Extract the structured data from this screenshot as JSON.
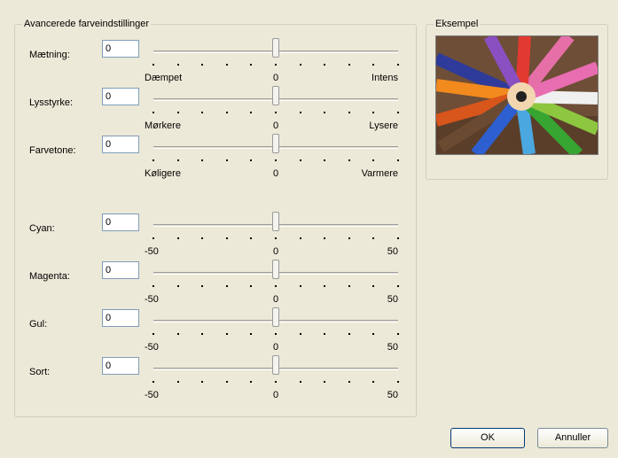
{
  "advanced_group": {
    "title": "Avancerede farveindstillinger"
  },
  "sliders": [
    {
      "id": "saturation",
      "label": "Mætning:",
      "value": "0",
      "min_label": "Dæmpet",
      "mid_label": "0",
      "max_label": "Intens",
      "level": 0.5
    },
    {
      "id": "brightness",
      "label": "Lysstyrke:",
      "value": "0",
      "min_label": "Mørkere",
      "mid_label": "0",
      "max_label": "Lysere",
      "level": 0.5
    },
    {
      "id": "hue",
      "label": "Farvetone:",
      "value": "0",
      "min_label": "Køligere",
      "mid_label": "0",
      "max_label": "Varmere",
      "level": 0.5
    },
    {
      "id": "cyan",
      "label": "Cyan:",
      "value": "0",
      "min_label": "-50",
      "mid_label": "0",
      "max_label": "50",
      "level": 0.5
    },
    {
      "id": "magenta",
      "label": "Magenta:",
      "value": "0",
      "min_label": "-50",
      "mid_label": "0",
      "max_label": "50",
      "level": 0.5
    },
    {
      "id": "yellow",
      "label": "Gul:",
      "value": "0",
      "min_label": "-50",
      "mid_label": "0",
      "max_label": "50",
      "level": 0.5
    },
    {
      "id": "black",
      "label": "Sort:",
      "value": "0",
      "min_label": "-50",
      "mid_label": "0",
      "max_label": "50",
      "level": 0.5
    }
  ],
  "example_group": {
    "title": "Eksempel",
    "image_icon": "colored-pencils-image"
  },
  "buttons": {
    "ok": "OK",
    "cancel": "Annuller"
  }
}
